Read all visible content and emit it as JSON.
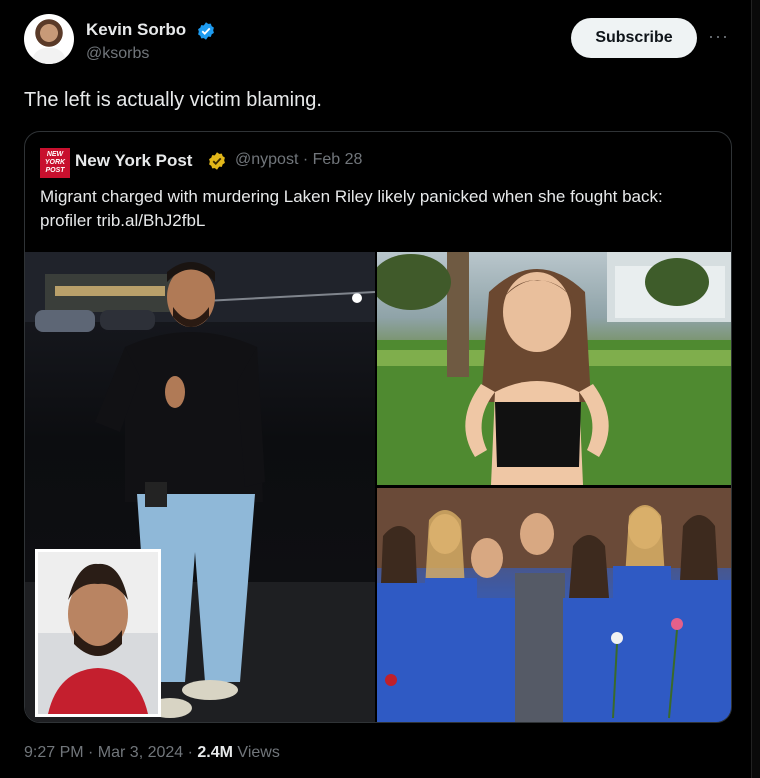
{
  "author": {
    "name": "Kevin Sorbo",
    "handle": "@ksorbs",
    "verified_icon": "verified-badge-icon"
  },
  "actions": {
    "subscribe_label": "Subscribe",
    "more_label": "···"
  },
  "post": {
    "text": "The left is actually victim blaming."
  },
  "quote": {
    "logo_text": "NEW YORK POST",
    "name": "New York Post",
    "meta": "@nypost · Feb 28",
    "text": "Migrant charged with murdering Laken Riley likely panicked when she fought back: profiler trib.al/BhJ2fbL",
    "badge_icon": "gold-verified-badge-icon"
  },
  "footer": {
    "time": "9:27 PM · Mar 3, 2024 · ",
    "views_count": "2.4M",
    "views_label": " Views"
  },
  "colors": {
    "background": "#000000",
    "text": "#e7e9ea",
    "muted": "#71767b",
    "verified_blue": "#1d9bf0",
    "gold_badge": "#e2b719",
    "nypost_red": "#c8102e"
  }
}
